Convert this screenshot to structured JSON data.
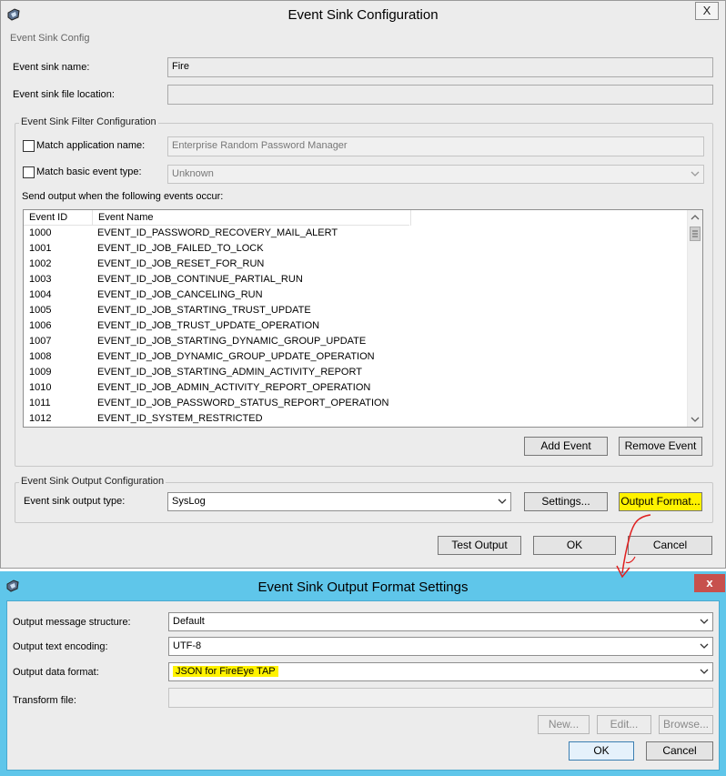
{
  "dialog1": {
    "title": "Event Sink Configuration",
    "close": "X",
    "group_title": "Event Sink Config",
    "name_label": "Event sink name:",
    "name_value": "Fire",
    "file_label": "Event sink file location:",
    "file_value": "",
    "filter": {
      "title": "Event Sink Filter Configuration",
      "match_app_label": "Match application name:",
      "match_app_value": "Enterprise Random Password Manager",
      "match_event_label": "Match basic event type:",
      "match_event_value": "Unknown",
      "send_label": "Send output when the following events occur:",
      "columns": [
        "Event ID",
        "Event Name"
      ],
      "rows": [
        {
          "id": "1000",
          "name": "EVENT_ID_PASSWORD_RECOVERY_MAIL_ALERT"
        },
        {
          "id": "1001",
          "name": "EVENT_ID_JOB_FAILED_TO_LOCK"
        },
        {
          "id": "1002",
          "name": "EVENT_ID_JOB_RESET_FOR_RUN"
        },
        {
          "id": "1003",
          "name": "EVENT_ID_JOB_CONTINUE_PARTIAL_RUN"
        },
        {
          "id": "1004",
          "name": "EVENT_ID_JOB_CANCELING_RUN"
        },
        {
          "id": "1005",
          "name": "EVENT_ID_JOB_STARTING_TRUST_UPDATE"
        },
        {
          "id": "1006",
          "name": "EVENT_ID_JOB_TRUST_UPDATE_OPERATION"
        },
        {
          "id": "1007",
          "name": "EVENT_ID_JOB_STARTING_DYNAMIC_GROUP_UPDATE"
        },
        {
          "id": "1008",
          "name": "EVENT_ID_JOB_DYNAMIC_GROUP_UPDATE_OPERATION"
        },
        {
          "id": "1009",
          "name": "EVENT_ID_JOB_STARTING_ADMIN_ACTIVITY_REPORT"
        },
        {
          "id": "1010",
          "name": "EVENT_ID_JOB_ADMIN_ACTIVITY_REPORT_OPERATION"
        },
        {
          "id": "1011",
          "name": "EVENT_ID_JOB_PASSWORD_STATUS_REPORT_OPERATION"
        },
        {
          "id": "1012",
          "name": "EVENT_ID_SYSTEM_RESTRICTED"
        }
      ],
      "add_event": "Add Event",
      "remove_event": "Remove Event"
    },
    "output": {
      "title": "Event Sink Output Configuration",
      "type_label": "Event sink output type:",
      "type_value": "SysLog",
      "settings": "Settings...",
      "output_format": "Output Format..."
    },
    "test_output": "Test Output",
    "ok": "OK",
    "cancel": "Cancel"
  },
  "dialog2": {
    "title": "Event Sink Output Format Settings",
    "close": "x",
    "structure_label": "Output message structure:",
    "structure_value": "Default",
    "encoding_label": "Output text encoding:",
    "encoding_value": "UTF-8",
    "format_label": "Output data format:",
    "format_value": "JSON for FireEye TAP",
    "transform_label": "Transform file:",
    "transform_value": "",
    "new": "New...",
    "edit": "Edit...",
    "browse": "Browse...",
    "ok": "OK",
    "cancel": "Cancel"
  },
  "colors": {
    "highlight": "#fff200",
    "annotation_arrow": "#e02020",
    "dialog2_frame": "#5fc6ea",
    "close_red": "#c7504d"
  },
  "icons": [
    "app-shield-icon",
    "close-icon",
    "chevron-down-icon",
    "scroll-up-icon",
    "scroll-down-icon"
  ]
}
